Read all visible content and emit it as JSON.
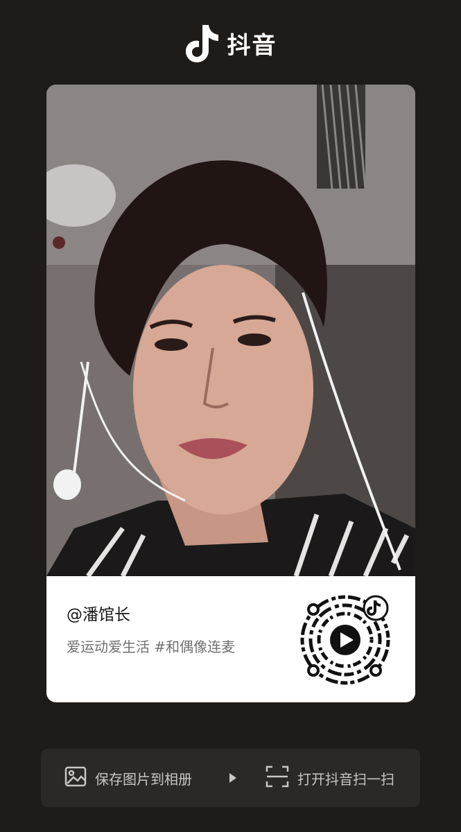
{
  "header": {
    "app_name": "抖音",
    "logo_icon": "douyin-note-icon"
  },
  "card": {
    "username": "@潘馆长",
    "caption": "爱运动爱生活 #和偶像连麦",
    "qr_icon": "douyin-qr-code",
    "qr_center_icon": "play-icon"
  },
  "actions": {
    "save_label": "保存图片到相册",
    "save_icon": "image-icon",
    "arrow_icon": "triangle-right-icon",
    "scan_label": "打开抖音扫一扫",
    "scan_icon": "scan-icon"
  },
  "colors": {
    "background": "#1f1b19",
    "card_bg": "#ffffff",
    "action_bar_bg": "#2c2826",
    "action_text": "#c9c6c4",
    "accent_cyan": "#25f4ee",
    "accent_red": "#fe2c55"
  }
}
